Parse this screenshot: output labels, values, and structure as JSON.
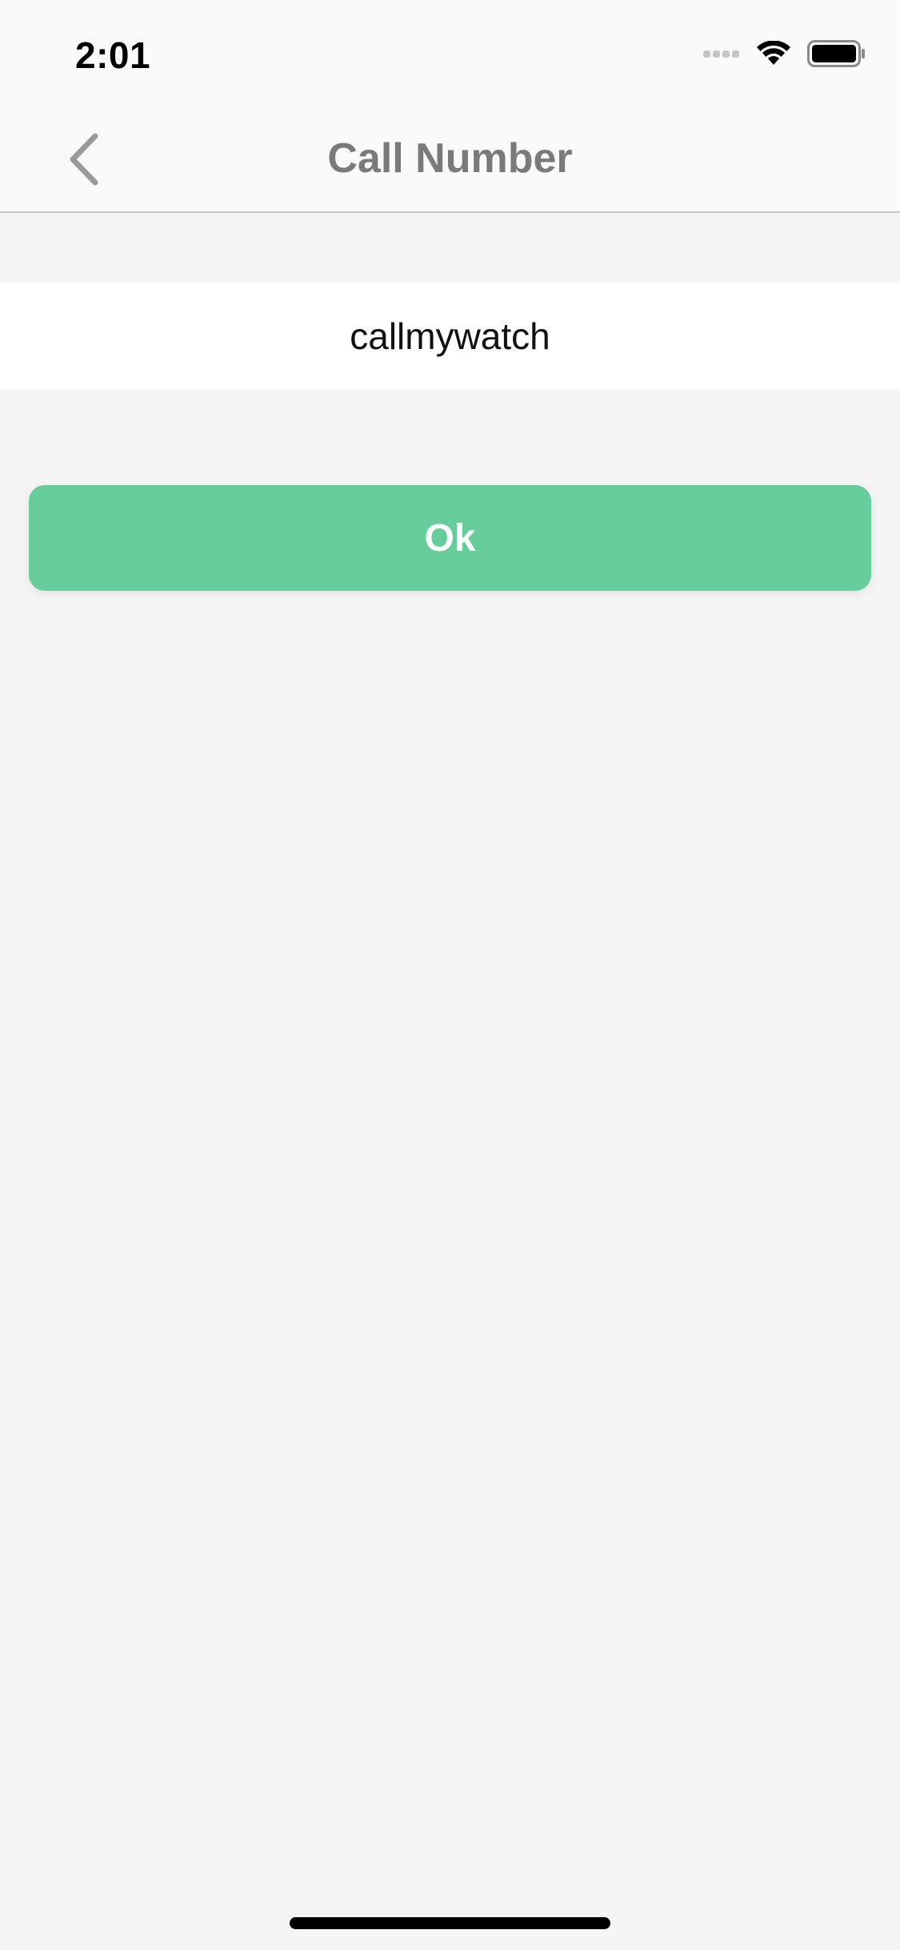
{
  "status_bar": {
    "time": "2:01",
    "icons": [
      "signal-icon",
      "wifi-icon",
      "battery-icon"
    ]
  },
  "nav": {
    "back_icon": "chevron-left-icon",
    "title": "Call Number"
  },
  "form": {
    "value": "callmywatch"
  },
  "actions": {
    "ok_label": "Ok"
  },
  "colors": {
    "accent": "#66cc99",
    "background": "#f5f5f5",
    "title": "#7a7a7a"
  }
}
